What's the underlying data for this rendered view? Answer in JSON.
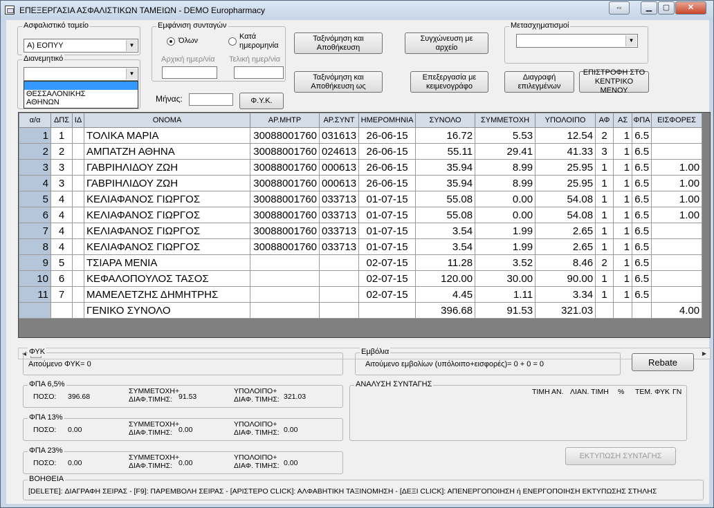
{
  "window": {
    "title": "ΕΠΕΞΕΡΓΑΣΙΑ ΑΣΦΑΛΙΣΤΙΚΩΝ ΤΑΜΕΙΩΝ - DEMO Europharmacy",
    "restore_glyph": "⇔",
    "minimize_glyph": "▁",
    "maximize_glyph": "▢",
    "close_glyph": "✕"
  },
  "fund": {
    "label": "Ασφαλιστικό ταμείο",
    "value": "Α) ΕΟΠΥΥ"
  },
  "distributor": {
    "label": "Διανεμητικό",
    "value": "",
    "options": [
      "",
      "ΘΕΣΣΑΛΟΝΙΚΗΣ",
      "ΑΘΗΝΩΝ"
    ]
  },
  "display": {
    "label": "Εμφάνιση συνταγών",
    "all_label": "Όλων",
    "by_date_label_line1": "Κατά",
    "by_date_label_line2": "ημερομηνία",
    "start_date_label": "Αρχική ημερ/νία",
    "end_date_label": "Τελική ημερ/νία"
  },
  "month": {
    "label": "Μήνας:",
    "value": ""
  },
  "buttons": {
    "fyk": "Φ.Υ.Κ.",
    "sort_save_line1": "Ταξινόμηση και",
    "sort_save_line2": "Αποθήκευση",
    "merge_line1": "Συγχώνευση με",
    "merge_line2": "αρχείο",
    "sort_save_as_line1": "Ταξινόμηση και",
    "sort_save_as_line2": "Αποθήκευση ως",
    "edit_word_line1": "Επεξεργασία με",
    "edit_word_line2": "κειμενογράφο",
    "delete_sel_line1": "Διαγραφή",
    "delete_sel_line2": "επιλεγμένων",
    "back_line1": "ΕΠΙΣΤΡΟΦΗ ΣΤΟ",
    "back_line2": "ΚΕΝΤΡΙΚΟ ΜΕΝΟΥ",
    "rebate": "Rebate",
    "print": "ΕΚΤΥΠΩΣΗ ΣΥΝΤΑΓΗΣ"
  },
  "transforms": {
    "label": "Μετασχηματισμοί",
    "value": ""
  },
  "table": {
    "columns": [
      "α/α",
      "ΔΠΣ",
      "ΙΔ",
      "ΟΝΟΜΑ",
      "ΑΡ.ΜΗΤΡ",
      "ΑΡ.ΣΥΝΤ",
      "ΗΜΕΡΟΜΗΝΙΑ",
      "ΣΥΝΟΛΟ",
      "ΣΥΜΜΕΤΟΧΗ",
      "ΥΠΟΛΟΙΠΟ",
      "ΑΦ",
      "ΑΣ",
      "ΦΠΑ",
      "ΕΙΣΦΟΡΕΣ"
    ],
    "rows": [
      [
        "1",
        "1",
        "",
        "ΤΟΛΙΚΑ ΜΑΡΙΑ",
        "30088001760",
        "031613",
        "26-06-15",
        "16.72",
        "5.53",
        "12.54",
        "2",
        "1",
        "6.5",
        ""
      ],
      [
        "2",
        "2",
        "",
        "ΑΜΠΑΤΖΗ ΑΘΗΝΑ",
        "30088001760",
        "024613",
        "26-06-15",
        "55.11",
        "29.41",
        "41.33",
        "3",
        "1",
        "6.5",
        ""
      ],
      [
        "3",
        "3",
        "",
        "ΓΑΒΡΙΗΛΙΔΟΥ ΖΩΗ",
        "30088001760",
        "000613",
        "26-06-15",
        "35.94",
        "8.99",
        "25.95",
        "1",
        "1",
        "6.5",
        "1.00"
      ],
      [
        "4",
        "3",
        "",
        "ΓΑΒΡΙΗΛΙΔΟΥ ΖΩΗ",
        "30088001760",
        "000613",
        "26-06-15",
        "35.94",
        "8.99",
        "25.95",
        "1",
        "1",
        "6.5",
        "1.00"
      ],
      [
        "5",
        "4",
        "",
        "ΚΕΛΙΑΦΑΝΟΣ ΓΙΩΡΓΟΣ",
        "30088001760",
        "033713",
        "01-07-15",
        "55.08",
        "0.00",
        "54.08",
        "1",
        "1",
        "6.5",
        "1.00"
      ],
      [
        "6",
        "4",
        "",
        "ΚΕΛΙΑΦΑΝΟΣ ΓΙΩΡΓΟΣ",
        "30088001760",
        "033713",
        "01-07-15",
        "55.08",
        "0.00",
        "54.08",
        "1",
        "1",
        "6.5",
        "1.00"
      ],
      [
        "7",
        "4",
        "",
        "ΚΕΛΙΑΦΑΝΟΣ ΓΙΩΡΓΟΣ",
        "30088001760",
        "033713",
        "01-07-15",
        "3.54",
        "1.99",
        "2.65",
        "1",
        "1",
        "6.5",
        ""
      ],
      [
        "8",
        "4",
        "",
        "ΚΕΛΙΑΦΑΝΟΣ ΓΙΩΡΓΟΣ",
        "30088001760",
        "033713",
        "01-07-15",
        "3.54",
        "1.99",
        "2.65",
        "1",
        "1",
        "6.5",
        ""
      ],
      [
        "9",
        "5",
        "",
        "ΤΣΙΑΡΑ ΜΕΝΙΑ",
        "",
        "",
        "02-07-15",
        "11.28",
        "3.52",
        "8.46",
        "2",
        "1",
        "6.5",
        ""
      ],
      [
        "10",
        "6",
        "",
        "ΚΕΦΑΛΟΠΟΥΛΟΣ ΤΑΣΟΣ",
        "",
        "",
        "02-07-15",
        "120.00",
        "30.00",
        "90.00",
        "1",
        "1",
        "6.5",
        ""
      ],
      [
        "11",
        "7",
        "",
        "ΜΑΜΕΛΕΤΖΗΣ ΔΗΜΗΤΡΗΣ",
        "",
        "",
        "02-07-15",
        "4.45",
        "1.11",
        "3.34",
        "1",
        "1",
        "6.5",
        ""
      ]
    ],
    "total": [
      "",
      "",
      "",
      "ΓΕΝΙΚΟ ΣΥΝΟΛΟ",
      "",
      "",
      "",
      "396.68",
      "91.53",
      "321.03",
      "",
      "",
      "",
      "4.00"
    ]
  },
  "fyk": {
    "label": "ΦΥΚ",
    "text": "Αιτούμενο ΦΥΚ=  0"
  },
  "vaccines": {
    "label": "Εμβόλια",
    "text": "Αιτούμενο εμβολίων (υπόλοιπο+εισφορές)=  0 +  0  =  0"
  },
  "vat_groups": [
    {
      "label": "ΦΠΑ 6,5%",
      "poso_label": "ΠΟΣΟ:",
      "poso": "396.68",
      "symm_label1": "ΣΥΜΜΕΤΟΧΗ+",
      "symm_label2": "ΔΙΑΦ.ΤΙΜΗΣ:",
      "symm": "91.53",
      "ypol_label1": "ΥΠΟΛΟΙΠΟ+",
      "ypol_label2": "ΔΙΑΦ. ΤΙΜΗΣ:",
      "ypol": "321.03"
    },
    {
      "label": "ΦΠΑ 13%",
      "poso_label": "ΠΟΣΟ:",
      "poso": "0.00",
      "symm_label1": "ΣΥΜΜΕΤΟΧΗ+",
      "symm_label2": "ΔΙΑΦ.ΤΙΜΗΣ:",
      "symm": "0.00",
      "ypol_label1": "ΥΠΟΛΟΙΠΟ+",
      "ypol_label2": "ΔΙΑΦ. ΤΙΜΗΣ:",
      "ypol": "0.00"
    },
    {
      "label": "ΦΠΑ 23%",
      "poso_label": "ΠΟΣΟ:",
      "poso": "0.00",
      "symm_label1": "ΣΥΜΜΕΤΟΧΗ+",
      "symm_label2": "ΔΙΑΦ.ΤΙΜΗΣ:",
      "symm": "0.00",
      "ypol_label1": "ΥΠΟΛΟΙΠΟ+",
      "ypol_label2": "ΔΙΑΦ. ΤΙΜΗΣ:",
      "ypol": "0.00"
    }
  ],
  "analysis": {
    "label": "ΑΝΑΛΥΣΗ ΣΥΝΤΑΓΗΣ",
    "columns": [
      "ΤΙΜΗ ΑΝ.",
      "ΛΙΑΝ. ΤΙΜΗ",
      "%",
      "ΤΕΜ. ΦΥΚ",
      "ΓΝ"
    ]
  },
  "help": {
    "label": "ΒΟΗΘΕΙΑ",
    "text": "[DELETE]: ΔΙΑΓΡΑΦΗ ΣΕΙΡΑΣ - [F9]: ΠΑΡΕΜΒΟΛΗ ΣΕΙΡΑΣ - [ΑΡΙΣΤΕΡΟ CLICK]: ΑΛΦΑΒΗΤΙΚΗ ΤΑΞΙΝΟΜΗΣΗ - [ΔΕΞΙ CLICK]: ΑΠΕΝΕΡΓΟΠΟΙΗΣΗ ή ΕΝΕΡΓΟΠΟΙΗΣΗ ΕΚΤΥΠΩΣΗΣ ΣΤΗΛΗΣ"
  },
  "scroll": {
    "left_glyph": "◀",
    "right_glyph": "▶"
  }
}
